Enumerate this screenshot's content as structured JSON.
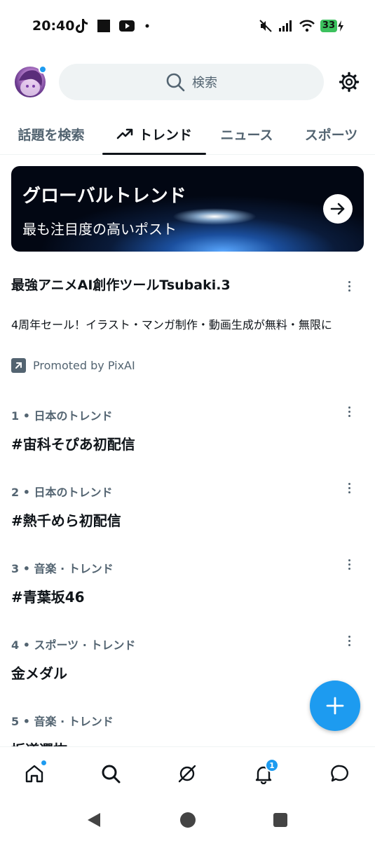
{
  "status_bar": {
    "time": "20:40",
    "left_icons": [
      "tiktok-icon",
      "square-icon",
      "youtube-icon",
      "dot-icon"
    ],
    "right_icons": [
      "mute-icon",
      "signal-icon",
      "wifi-icon"
    ],
    "battery": "33"
  },
  "header": {
    "search_placeholder": "検索"
  },
  "tabs": [
    {
      "label": "話題を検索",
      "active": false
    },
    {
      "label": "トレンド",
      "active": true
    },
    {
      "label": "ニュース",
      "active": false
    },
    {
      "label": "スポーツ",
      "active": false
    }
  ],
  "banner": {
    "title": "グローバルトレンド",
    "subtitle": "最も注目度の高いポスト"
  },
  "promoted": {
    "title": "最強アニメAI創作ツールTsubaki.3",
    "description": "4周年セール！イラスト・マンガ制作・動画生成が無料・無限に",
    "by": "Promoted by PixAI"
  },
  "trends": [
    {
      "meta": "1 • 日本のトレンド",
      "name": "#宙科そぴあ初配信"
    },
    {
      "meta": "2 • 日本のトレンド",
      "name": "#熱千めら初配信"
    },
    {
      "meta": "3 • 音楽 · トレンド",
      "name": "#青葉坂46"
    },
    {
      "meta": "4 • スポーツ · トレンド",
      "name": "金メダル"
    },
    {
      "meta": "5 • 音楽 · トレンド",
      "name": "坂道選抜"
    }
  ],
  "bottom_nav": {
    "items": [
      "home-icon",
      "search-icon",
      "grok-icon",
      "notifications-icon",
      "messages-icon"
    ],
    "notification_count": "1"
  },
  "colors": {
    "accent": "#1d9bf0",
    "text_primary": "#0f1419",
    "text_secondary": "#536471"
  }
}
